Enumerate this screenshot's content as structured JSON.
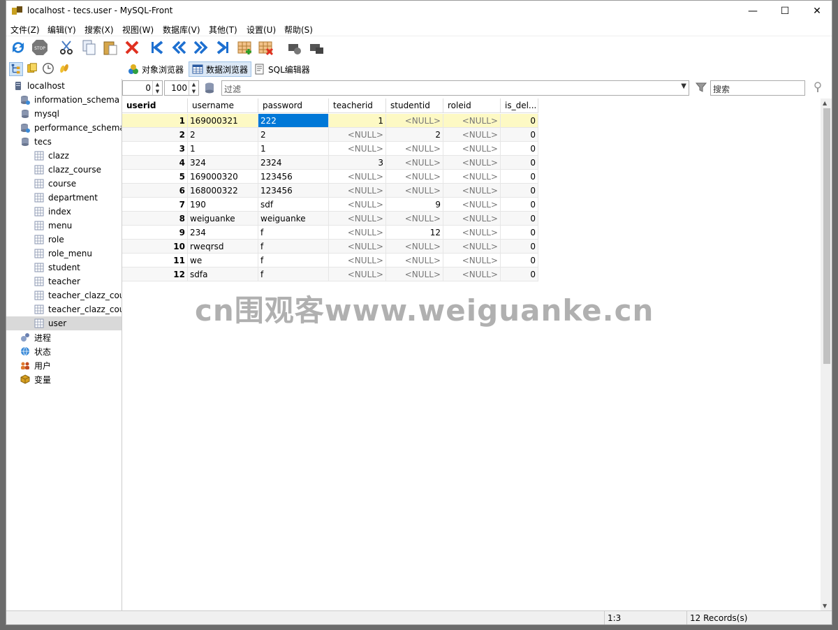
{
  "window": {
    "title": "localhost - tecs.user - MySQL-Front",
    "minimize": "—",
    "maximize": "☐",
    "close": "✕"
  },
  "menu": [
    "文件(Z)",
    "编辑(Y)",
    "搜索(X)",
    "视图(W)",
    "数据库(V)",
    "其他(T)",
    "设置(U)",
    "帮助(S)"
  ],
  "tabs": {
    "objects": "对象浏览器",
    "data": "数据浏览器",
    "sql": "SQL编辑器"
  },
  "tree": [
    {
      "label": "localhost",
      "level": 0,
      "icon": "server-icon"
    },
    {
      "label": "information_schema",
      "level": 1,
      "icon": "database-system-icon"
    },
    {
      "label": "mysql",
      "level": 1,
      "icon": "database-icon"
    },
    {
      "label": "performance_schema",
      "level": 1,
      "icon": "database-system-icon"
    },
    {
      "label": "tecs",
      "level": 1,
      "icon": "database-icon"
    },
    {
      "label": "clazz",
      "level": 2,
      "icon": "table-icon"
    },
    {
      "label": "clazz_course",
      "level": 2,
      "icon": "table-icon"
    },
    {
      "label": "course",
      "level": 2,
      "icon": "table-icon"
    },
    {
      "label": "department",
      "level": 2,
      "icon": "table-icon"
    },
    {
      "label": "index",
      "level": 2,
      "icon": "table-icon"
    },
    {
      "label": "menu",
      "level": 2,
      "icon": "table-icon"
    },
    {
      "label": "role",
      "level": 2,
      "icon": "table-icon"
    },
    {
      "label": "role_menu",
      "level": 2,
      "icon": "table-icon"
    },
    {
      "label": "student",
      "level": 2,
      "icon": "table-icon"
    },
    {
      "label": "teacher",
      "level": 2,
      "icon": "table-icon"
    },
    {
      "label": "teacher_clazz_cours",
      "level": 2,
      "icon": "table-icon"
    },
    {
      "label": "teacher_clazz_cours",
      "level": 2,
      "icon": "table-icon"
    },
    {
      "label": "user",
      "level": 2,
      "icon": "table-icon",
      "selected": true
    },
    {
      "label": "进程",
      "level": 1,
      "icon": "process-icon"
    },
    {
      "label": "状态",
      "level": 1,
      "icon": "globe-icon"
    },
    {
      "label": "用户",
      "level": 1,
      "icon": "users-icon"
    },
    {
      "label": "变量",
      "level": 1,
      "icon": "variables-icon"
    }
  ],
  "filter": {
    "offset": "0",
    "limit": "100",
    "filter_placeholder": "过滤",
    "search_placeholder": "搜索"
  },
  "table": {
    "columns": [
      "userid",
      "username",
      "password",
      "teacherid",
      "studentid",
      "roleid",
      "is_del..."
    ],
    "rows": [
      [
        "1",
        "169000321",
        "222",
        "1",
        "<NULL>",
        "<NULL>",
        "0"
      ],
      [
        "2",
        "2",
        "2",
        "<NULL>",
        "2",
        "<NULL>",
        "0"
      ],
      [
        "3",
        "1",
        "1",
        "<NULL>",
        "<NULL>",
        "<NULL>",
        "0"
      ],
      [
        "4",
        "324",
        "2324",
        "3",
        "<NULL>",
        "<NULL>",
        "0"
      ],
      [
        "5",
        "169000320",
        "123456",
        "<NULL>",
        "<NULL>",
        "<NULL>",
        "0"
      ],
      [
        "6",
        "168000322",
        "123456",
        "<NULL>",
        "<NULL>",
        "<NULL>",
        "0"
      ],
      [
        "7",
        "190",
        "sdf",
        "<NULL>",
        "9",
        "<NULL>",
        "0"
      ],
      [
        "8",
        "weiguanke",
        "weiguanke",
        "<NULL>",
        "<NULL>",
        "<NULL>",
        "0"
      ],
      [
        "9",
        "234",
        "f",
        "<NULL>",
        "12",
        "<NULL>",
        "0"
      ],
      [
        "10",
        "rweqrsd",
        "f",
        "<NULL>",
        "<NULL>",
        "<NULL>",
        "0"
      ],
      [
        "11",
        "we",
        "f",
        "<NULL>",
        "<NULL>",
        "<NULL>",
        "0"
      ],
      [
        "12",
        "sdfa",
        "f",
        "<NULL>",
        "<NULL>",
        "<NULL>",
        "0"
      ]
    ]
  },
  "status": {
    "position": "1:3",
    "records": "12 Records(s)"
  },
  "watermark": "cn围观客www.weiguanke.cn",
  "colors": {
    "selected_row": "#fdf9c4",
    "selected_cell": "#0078d7",
    "null_text": "#777777",
    "tree_selected": "#d9d9d9"
  }
}
